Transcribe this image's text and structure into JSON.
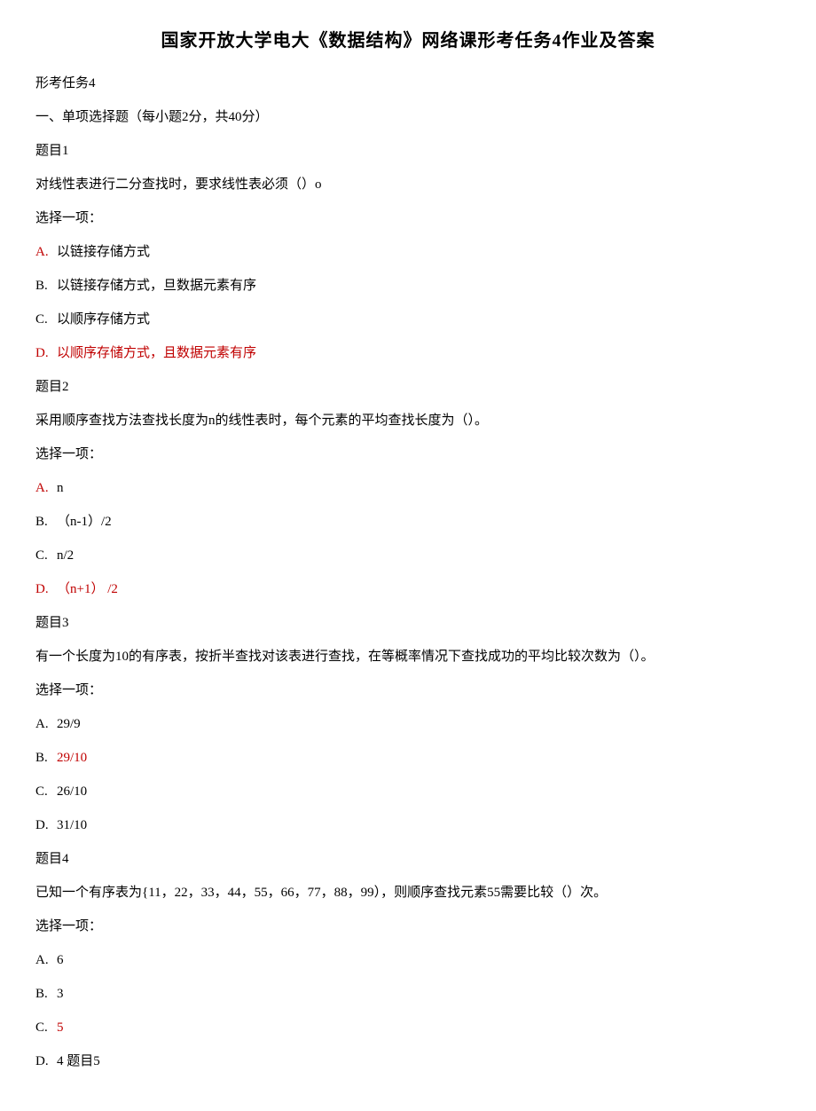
{
  "title": "国家开放大学电大《数据结构》网络课形考任务4作业及答案",
  "task_label": "形考任务4",
  "section_title": "一、单项选择题（每小题2分，共40分）",
  "questions": [
    {
      "heading": "题目1",
      "stem": "对线性表进行二分查找时，要求线性表必须（）o",
      "prompt": "选择一项：",
      "opts": [
        {
          "label": "A.",
          "text": "以链接存储方式",
          "label_red": true,
          "text_red": false
        },
        {
          "label": "B.",
          "text": "以链接存储方式，旦数据元素有序",
          "label_red": false,
          "text_red": false
        },
        {
          "label": "C.",
          "text": "以顺序存储方式",
          "label_red": false,
          "text_red": false
        },
        {
          "label": "D.",
          "text": "以顺序存储方式，且数据元素有序",
          "label_red": true,
          "text_red": true
        }
      ]
    },
    {
      "heading": "题目2",
      "stem": "采用顺序查找方法查找长度为n的线性表时，每个元素的平均查找长度为（）。",
      "prompt": "选择一项：",
      "opts": [
        {
          "label": "A.",
          "text": "n",
          "label_red": true,
          "text_red": false
        },
        {
          "label": "B.",
          "text": "（n-1）/2",
          "label_red": false,
          "text_red": false
        },
        {
          "label": "C.",
          "text": "n/2",
          "label_red": false,
          "text_red": false
        },
        {
          "label": "D.",
          "text": "（n+1） /2",
          "label_red": true,
          "text_red": true
        }
      ]
    },
    {
      "heading": "题目3",
      "stem": "有一个长度为10的有序表，按折半查找对该表进行查找，在等概率情况下查找成功的平均比较次数为（）。",
      "prompt": "选择一项：",
      "opts": [
        {
          "label": "A.",
          "text": "29/9",
          "label_red": false,
          "text_red": false
        },
        {
          "label": "B.",
          "text": "29/10",
          "label_red": false,
          "text_red": true
        },
        {
          "label": "C.",
          "text": "26/10",
          "label_red": false,
          "text_red": false
        },
        {
          "label": "D.",
          "text": "31/10",
          "label_red": false,
          "text_red": false
        }
      ]
    },
    {
      "heading": "题目4",
      "stem": "已知一个有序表为{11，22，33，44，55，66，77，88，99），则顺序查找元素55需要比较（）次。",
      "prompt": "选择一项：",
      "opts": [
        {
          "label": "A.",
          "text": "6",
          "label_red": false,
          "text_red": false
        },
        {
          "label": "B.",
          "text": "3",
          "label_red": false,
          "text_red": false
        },
        {
          "label": "C.",
          "text": "5",
          "label_red": false,
          "text_red": true
        },
        {
          "label": "D.",
          "text": "4 题目5",
          "label_red": false,
          "text_red": false
        }
      ]
    }
  ]
}
